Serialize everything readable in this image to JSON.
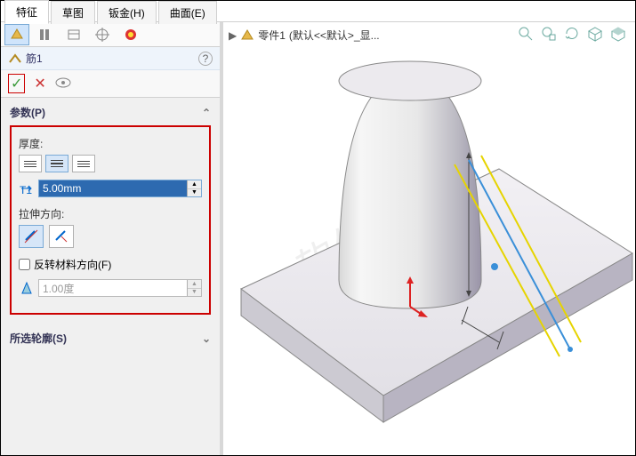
{
  "tabs": {
    "features": "特征",
    "sketch": "草图",
    "sheetmetal": "钣金(H)",
    "surface": "曲面(E)"
  },
  "feature": {
    "name": "筋1",
    "help": "?"
  },
  "controls": {
    "ok": "✓",
    "cancel": "✕",
    "preview": "◉"
  },
  "params": {
    "heading": "参数(P)",
    "thickness_label": "厚度:",
    "thickness_value": "5.00mm",
    "direction_label": "拉伸方向:",
    "reverse_label": "反转材料方向(F)",
    "draft_value": "1.00度"
  },
  "profile": {
    "heading": "所选轮廓(S)"
  },
  "breadcrumb": {
    "part": "零件1",
    "config": "(默认<<默认>_显..."
  },
  "colors": {
    "accent": "#cfe4fb",
    "redbox": "#c00",
    "line_yellow": "#e6d400",
    "line_blue": "#3a8fd8"
  }
}
